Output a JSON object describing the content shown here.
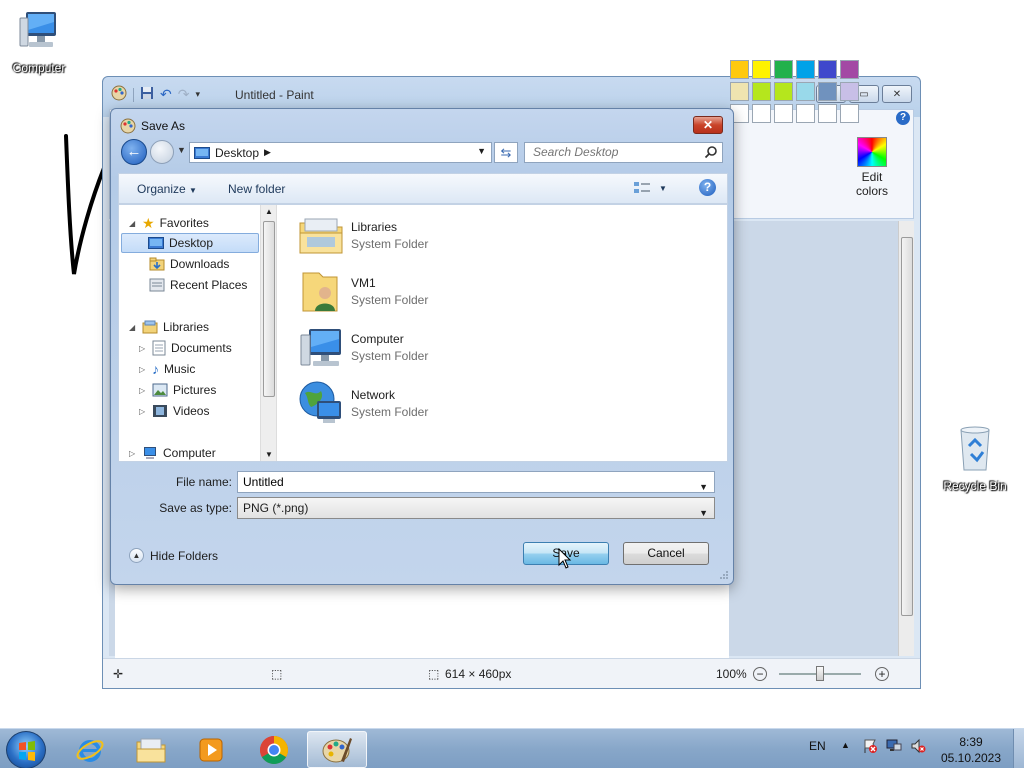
{
  "desktop": {
    "icons": [
      {
        "label": "Computer"
      },
      {
        "label": "Recycle Bin"
      }
    ]
  },
  "paint": {
    "title": "Untitled - Paint",
    "edit_colors_line1": "Edit",
    "edit_colors_line2": "colors",
    "help": "?",
    "palette": [
      "#ffc90e",
      "#fff200",
      "#22b14c",
      "#00a2e8",
      "#3f48cc",
      "#a349a4",
      "#efe4b0",
      "#b5e61d",
      "#b5e61d",
      "#99d9ea",
      "#7092be",
      "#c8bfe7",
      "#ffffff",
      "#ffffff",
      "#ffffff",
      "#ffffff",
      "#ffffff",
      "#ffffff"
    ],
    "status": {
      "size": "614 × 460px",
      "zoom": "100%"
    }
  },
  "dialog": {
    "title": "Save As",
    "address": "Desktop",
    "search_placeholder": "Search Desktop",
    "organize": "Organize",
    "new_folder": "New folder",
    "tree": [
      {
        "label": "Favorites"
      },
      {
        "label": "Desktop"
      },
      {
        "label": "Downloads"
      },
      {
        "label": "Recent Places"
      },
      {
        "label": "Libraries"
      },
      {
        "label": "Documents"
      },
      {
        "label": "Music"
      },
      {
        "label": "Pictures"
      },
      {
        "label": "Videos"
      },
      {
        "label": "Computer"
      }
    ],
    "files": [
      {
        "name": "Libraries",
        "type": "System Folder"
      },
      {
        "name": "VM1",
        "type": "System Folder"
      },
      {
        "name": "Computer",
        "type": "System Folder"
      },
      {
        "name": "Network",
        "type": "System Folder"
      }
    ],
    "file_name_label": "File name:",
    "file_name_value": "Untitled",
    "save_type_label": "Save as type:",
    "save_type_value": "PNG (*.png)",
    "hide_folders": "Hide Folders",
    "save": "Save",
    "cancel": "Cancel"
  },
  "taskbar": {
    "lang": "EN",
    "time": "8:39",
    "date": "05.10.2023"
  }
}
